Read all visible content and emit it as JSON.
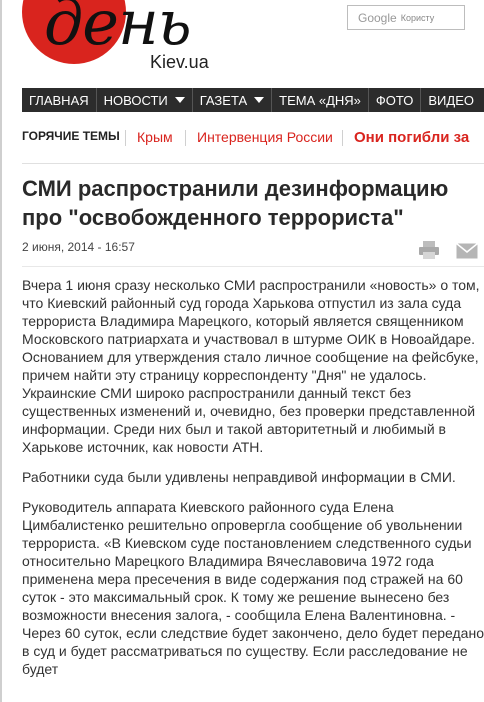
{
  "logo": {
    "word": "день",
    "site": "Kiev.ua"
  },
  "search": {
    "brand": "Google",
    "placeholder": "Користу"
  },
  "nav": {
    "items": [
      {
        "label": "ГЛАВНАЯ",
        "dropdown": false
      },
      {
        "label": "НОВОСТИ",
        "dropdown": true
      },
      {
        "label": "ГАЗЕТА",
        "dropdown": true
      },
      {
        "label": "ТЕМА «ДНЯ»",
        "dropdown": false
      },
      {
        "label": "ФОТО",
        "dropdown": false
      },
      {
        "label": "ВИДЕО",
        "dropdown": false
      }
    ]
  },
  "hot_topics": {
    "title": "ГОРЯЧИЕ ТЕМЫ",
    "links": [
      "Крым",
      "Интервенция России",
      "Они погибли за"
    ]
  },
  "article": {
    "title": "СМИ распространили дезинформацию про \"освобожденного террориста\"",
    "date": "2 июня, 2014 - 16:57",
    "paragraphs": [
      "Вчера 1 июня сразу несколько СМИ распространили «новость» о том, что Киевский районный суд города Харькова отпустил из зала суда террориста Владимира Марецкого, который является священником Московского патриархата и участвовал в штурме ОИК в Новоайдаре. Основанием для утверждения стало личное сообщение на фейсбуке, причем найти эту страницу корреспонденту \"Дня\" не удалось. Украинские СМИ широко распространили данный текст без существенных изменений и, очевидно, без проверки представленной информации. Среди них был и такой авторитетный и любимый в Харькове источник, как новости АТН.",
      "Работники суда были удивлены неправдивой информации в СМИ.",
      "Руководитель аппарата Киевского районного суда Елена Цимбалистенко решительно опровергла сообщение об увольнении террориста. «В Киевском суде постановлением следственного судьи относительно Марецкого Владимира Вячеславовича 1972 года применена мера пресечения в виде содержания под стражей на 60 суток - это максимальный срок. К тому же решение вынесено без возможности внесения залога, - сообщила Елена Валентиновна. - Через 60 суток, если следствие будет закончено, дело будет передано в суд и будет рассматриваться по существу. Если расследование не будет"
    ]
  },
  "colors": {
    "accent": "#d9241e",
    "nav_bg": "#2c2c2c"
  }
}
